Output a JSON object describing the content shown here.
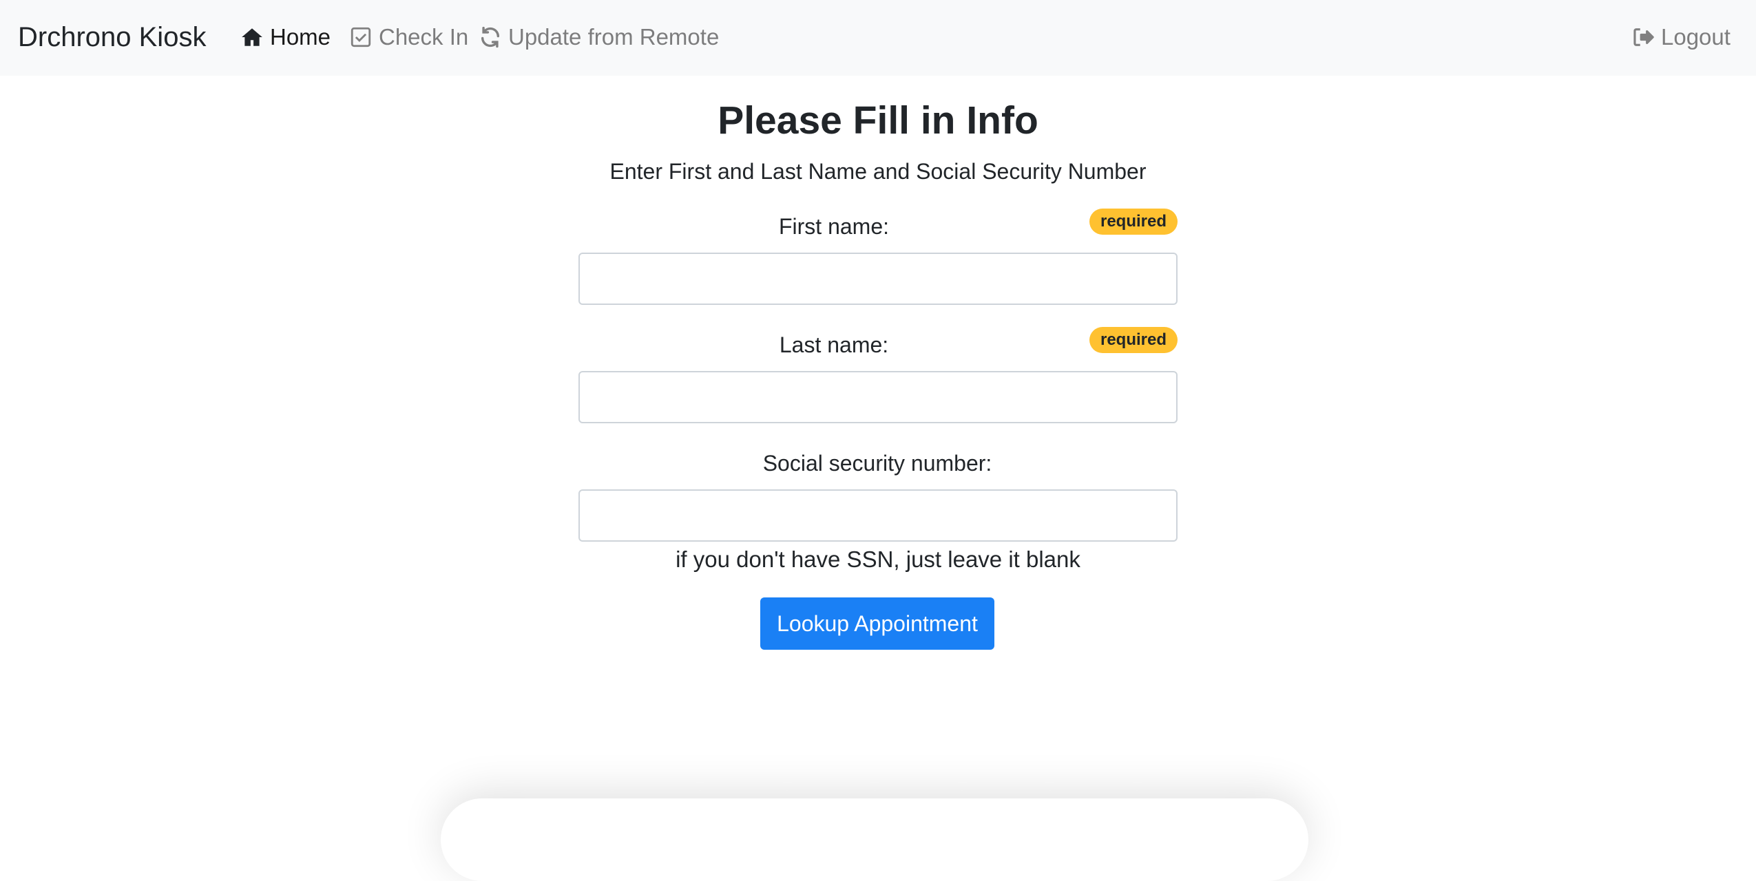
{
  "navbar": {
    "brand": "Drchrono Kiosk",
    "items": [
      {
        "label": "Home",
        "icon": "home-icon",
        "active": true
      },
      {
        "label": "Check In",
        "icon": "check-square-icon",
        "active": false
      },
      {
        "label": "Update from Remote",
        "icon": "refresh-icon",
        "active": false
      }
    ],
    "logout": {
      "label": "Logout",
      "icon": "sign-out-icon"
    }
  },
  "form": {
    "title": "Please Fill in Info",
    "subtitle": "Enter First and Last Name and Social Security Number",
    "fields": [
      {
        "label": "First name:",
        "badge": "required",
        "value": ""
      },
      {
        "label": "Last name:",
        "badge": "required",
        "value": ""
      },
      {
        "label": "Social security number:",
        "value": ""
      }
    ],
    "ssn_help": "if you don't have SSN, just leave it blank",
    "submit_label": "Lookup Appointment"
  },
  "colors": {
    "navbar_bg": "#f8f9fa",
    "badge_warning": "#ffc130",
    "primary": "#1a80f5"
  }
}
